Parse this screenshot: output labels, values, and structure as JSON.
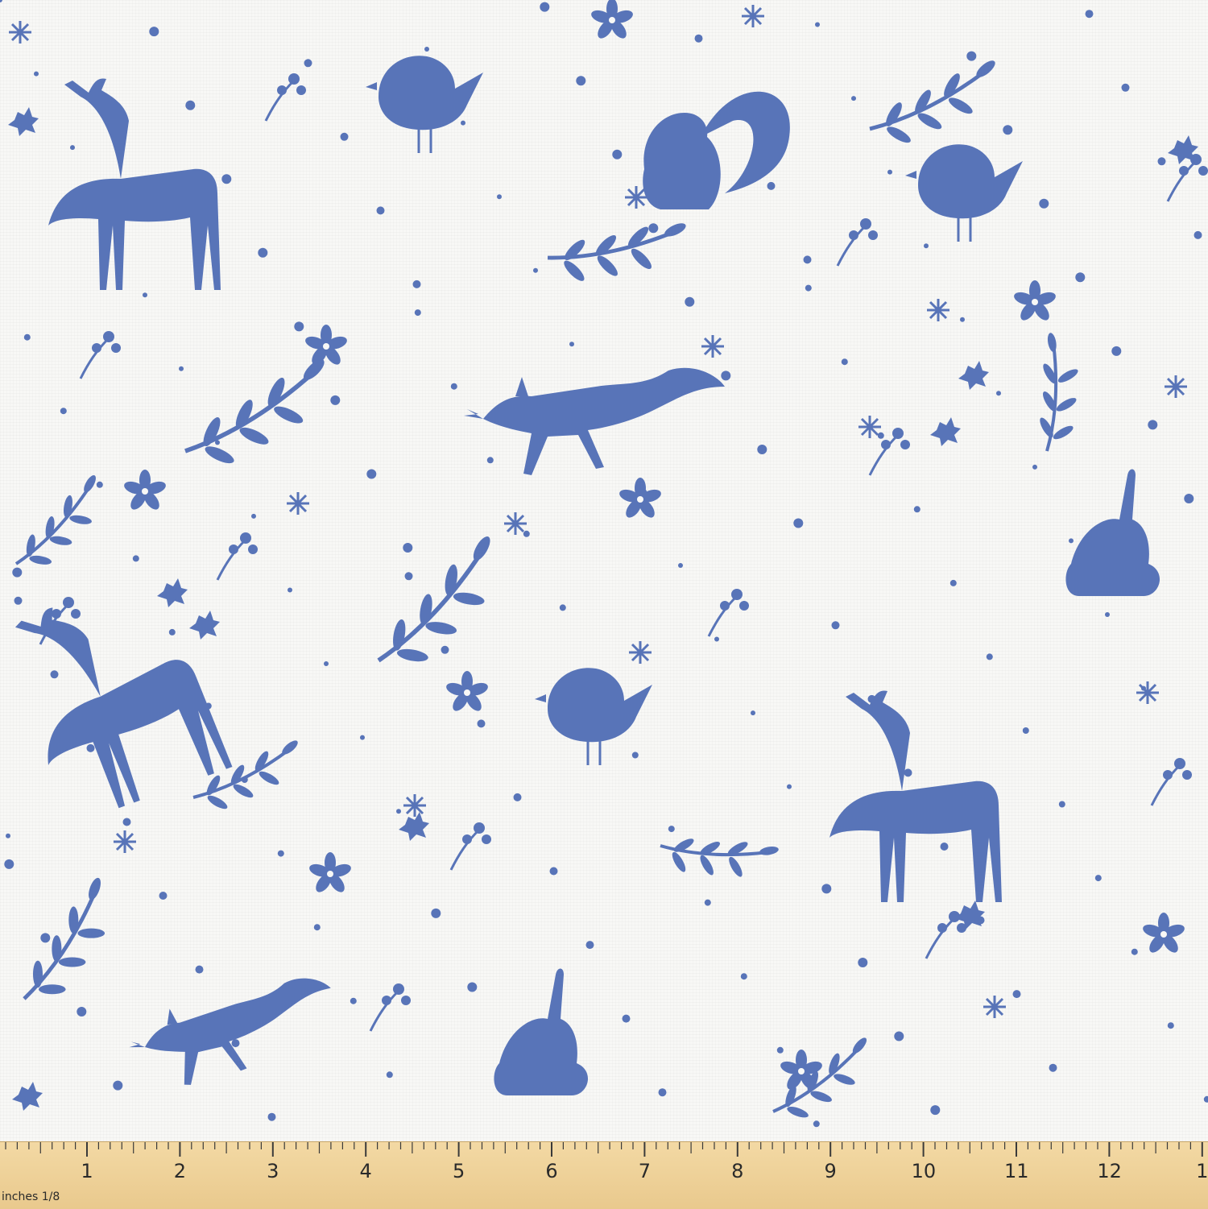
{
  "colors": {
    "motif": "#5874b8",
    "background": "#f8f8f6",
    "ruler": "#efd39a"
  },
  "fabric": {
    "motifs": [
      "deer",
      "fox",
      "rabbit",
      "bird",
      "squirrel",
      "stag",
      "berries",
      "leaves",
      "snowflakes",
      "holly"
    ]
  },
  "ruler": {
    "units_label": "inches",
    "fraction_label": "1/8",
    "numbers": [
      "1",
      "2",
      "3",
      "4",
      "5",
      "6",
      "7",
      "8",
      "9",
      "10",
      "11",
      "12",
      "1"
    ]
  }
}
